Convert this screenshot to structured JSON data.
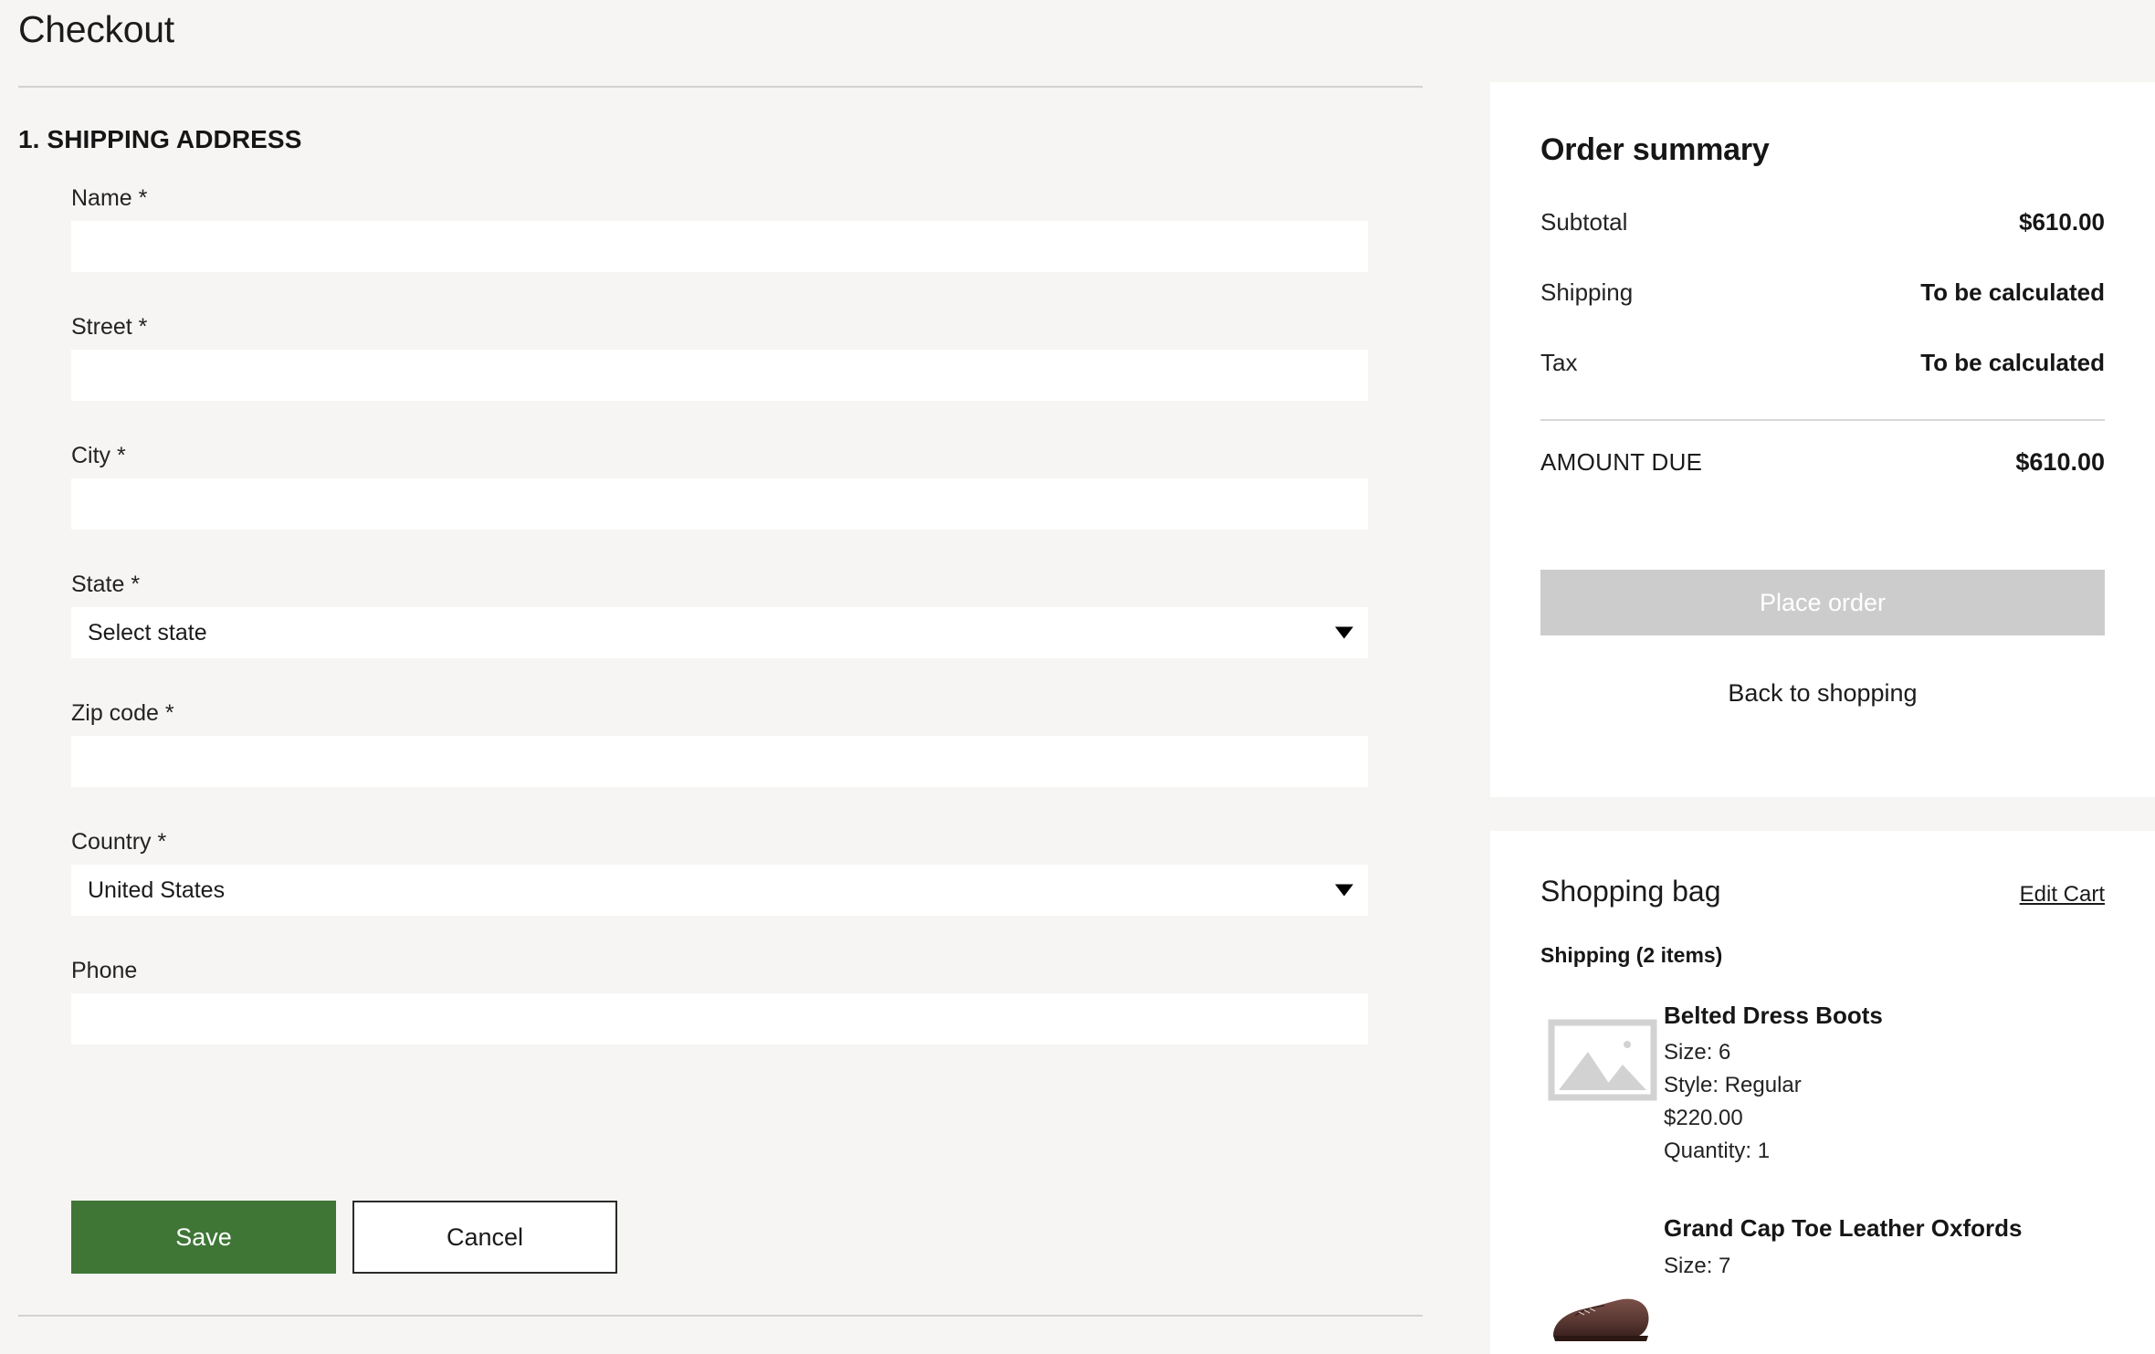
{
  "header": {
    "title": "Checkout"
  },
  "shipping_section": {
    "heading": "1. SHIPPING ADDRESS",
    "fields": [
      {
        "label": "Name *",
        "value": "",
        "placeholder": "",
        "type": "text"
      },
      {
        "label": "Street *",
        "value": "",
        "placeholder": "",
        "type": "text"
      },
      {
        "label": "City *",
        "value": "",
        "placeholder": "",
        "type": "text"
      },
      {
        "label": "State *",
        "value": "Select state",
        "type": "select"
      },
      {
        "label": "Zip code *",
        "value": "",
        "placeholder": "",
        "type": "text"
      },
      {
        "label": "Country *",
        "value": "United States",
        "type": "select"
      },
      {
        "label": "Phone",
        "value": "",
        "placeholder": "",
        "type": "text"
      }
    ],
    "save_label": "Save",
    "cancel_label": "Cancel"
  },
  "order_summary": {
    "title": "Order summary",
    "rows": [
      {
        "label": "Subtotal",
        "value": "$610.00"
      },
      {
        "label": "Shipping",
        "value": "To be calculated"
      },
      {
        "label": "Tax",
        "value": "To be calculated"
      }
    ],
    "total_label": "AMOUNT DUE",
    "total_value": "$610.00",
    "place_order_label": "Place order",
    "back_to_shopping_label": "Back to shopping"
  },
  "shopping_bag": {
    "title": "Shopping bag",
    "edit_label": "Edit Cart",
    "group_label": "Shipping (2 items)",
    "items": [
      {
        "name": "Belted Dress Boots",
        "size": "Size: 6",
        "style": "Style: Regular",
        "price": "$220.00",
        "quantity": "Quantity: 1",
        "thumb": "image-placeholder-icon"
      },
      {
        "name": "Grand Cap Toe Leather Oxfords",
        "size": "Size: 7",
        "style": "",
        "price": "",
        "quantity": "",
        "thumb": "leather-oxford-shoe-photo"
      }
    ]
  },
  "colors": {
    "page_background": "#f6f5f3",
    "card_background": "#ffffff",
    "save_button": "#3f7636",
    "place_order_disabled": "#cccccc",
    "divider": "#d2d2d2",
    "text": "#1b1b1b"
  }
}
